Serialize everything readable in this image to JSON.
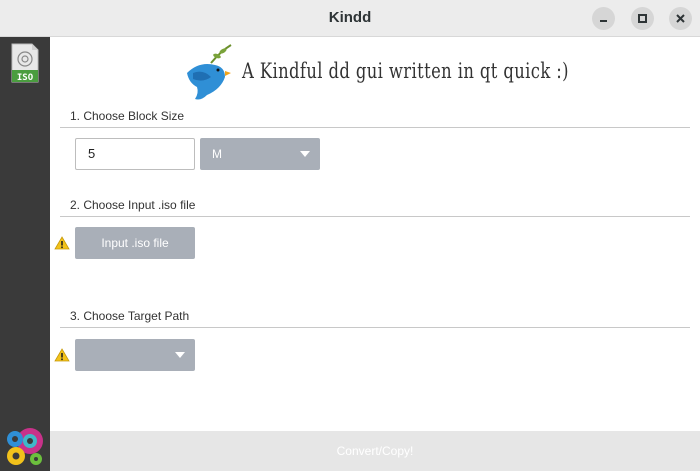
{
  "window": {
    "title": "Kindd"
  },
  "header": {
    "tagline": "A Kindful dd gui written in qt quick :)"
  },
  "sidebar": {
    "iso_label": "ISO"
  },
  "sections": {
    "block_size": {
      "label": "1. Choose Block Size",
      "value": "5",
      "unit": "M"
    },
    "input_iso": {
      "label": "2. Choose Input .iso file",
      "button_label": "Input .iso file"
    },
    "target": {
      "label": "3. Choose Target Path",
      "selected": ""
    }
  },
  "footer": {
    "convert_label": "Convert/Copy!"
  },
  "colors": {
    "sidebar": "#3a3a3a",
    "control": "#a9afb8",
    "accent_bird": "#2f8fd6",
    "warning": "#f2c21b"
  }
}
